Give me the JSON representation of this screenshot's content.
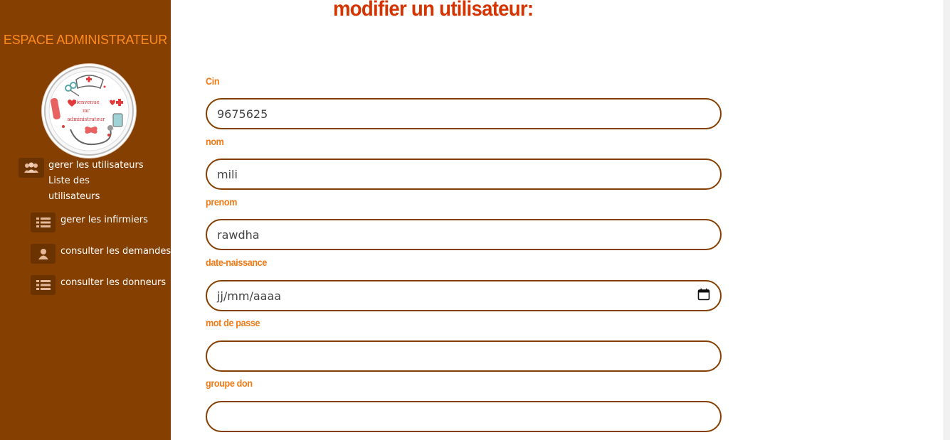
{
  "sidebar": {
    "title": "ESPACE ADMINISTRATEUR",
    "avatar": {
      "line1": "Bienvenue",
      "line2": "mr",
      "line3": "administrateur"
    },
    "items": [
      {
        "label": "gerer les utilisateurs",
        "sublabel1": "Liste des",
        "sublabel2": "utilisateurs",
        "icon": "users-icon"
      },
      {
        "label": "gerer les infirmiers",
        "icon": "list-icon"
      },
      {
        "label": "consulter les demandes",
        "icon": "user-icon"
      },
      {
        "label": "consulter les donneurs",
        "icon": "list-icon"
      }
    ]
  },
  "main": {
    "title": "modifier un utilisateur:",
    "fields": [
      {
        "label": "Cin",
        "value": "9675625",
        "type": "text"
      },
      {
        "label": "nom",
        "value": "mili",
        "type": "text"
      },
      {
        "label": "prenom",
        "value": "rawdha",
        "type": "text"
      },
      {
        "label": "date-naissance",
        "value": "jj/mm/aaaa",
        "type": "date"
      },
      {
        "label": "mot de passe",
        "value": "",
        "type": "password"
      },
      {
        "label": "groupe don",
        "value": "",
        "type": "text"
      }
    ]
  },
  "colors": {
    "sidebar_bg": "#853f00",
    "accent_orange": "#f07b16",
    "title_red": "#d53300",
    "border": "#853f00"
  }
}
